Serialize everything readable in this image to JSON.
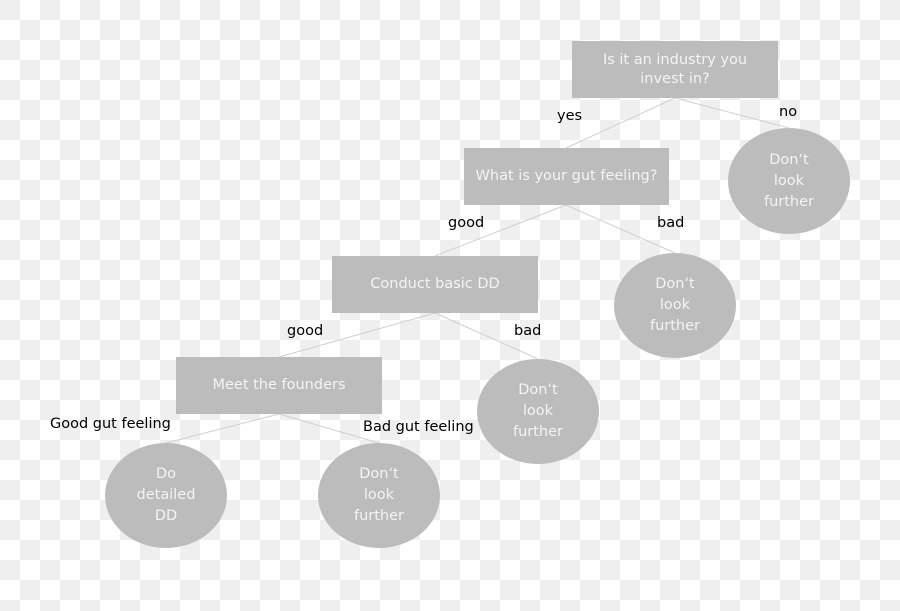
{
  "nodes": {
    "q_industry": "Is it an industry you invest in?",
    "q_gut": "What is your gut feeling?",
    "basic_dd": "Conduct basic DD",
    "meet_founders": "Meet the founders",
    "stop_industry": "Don‘t\nlook\nfurther",
    "stop_gut": "Don‘t\nlook\nfurther",
    "stop_dd": "Don‘t\nlook\nfurther",
    "stop_founders": "Don‘t\nlook\nfurther",
    "detailed_dd": "Do\ndetailed\nDD"
  },
  "edge_labels": {
    "yes": "yes",
    "no": "no",
    "gut_good": "good",
    "gut_bad": "bad",
    "dd_good": "good",
    "dd_bad": "bad",
    "founders_good": "Good gut feeling",
    "founders_bad": "Bad gut feeling"
  },
  "colors": {
    "node_fill": "#bcbcbc",
    "node_text": "#f4f4f4",
    "edge": "#d0d0d0"
  }
}
